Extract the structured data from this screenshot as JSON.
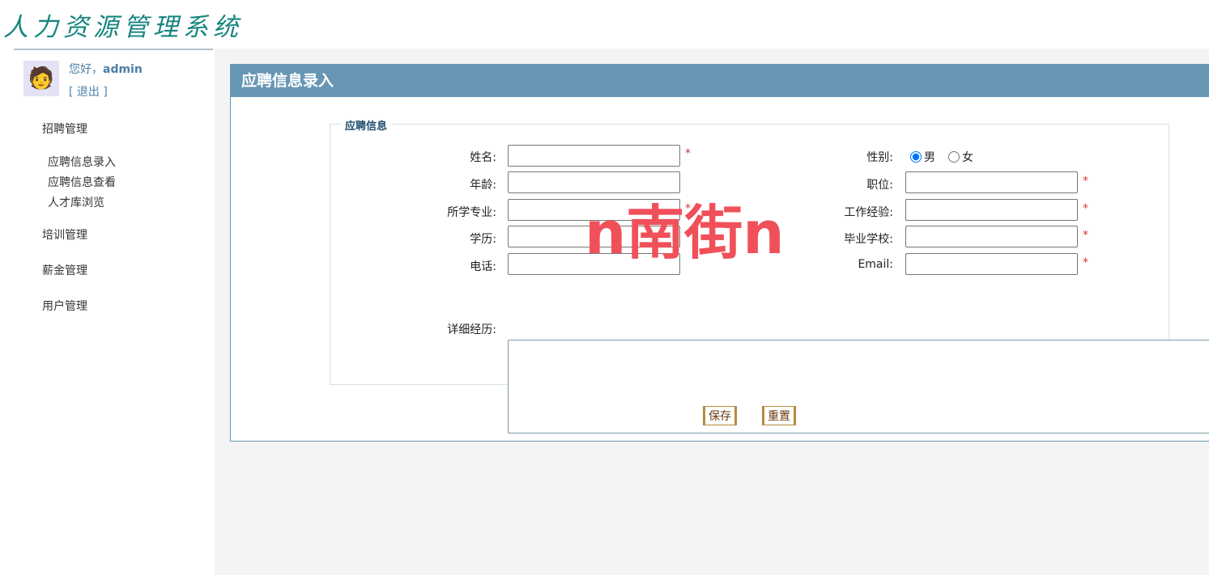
{
  "app": {
    "title": "人力资源管理系统"
  },
  "user": {
    "greeting": "您好，",
    "name": "admin",
    "logout": "[ 退出 ]"
  },
  "sidebar": {
    "groups": [
      {
        "label": "招聘管理",
        "items": [
          "应聘信息录入",
          "应聘信息查看",
          "人才库浏览"
        ]
      },
      {
        "label": "培训管理"
      },
      {
        "label": "薪金管理"
      },
      {
        "label": "用户管理"
      }
    ]
  },
  "panel": {
    "title": "应聘信息录入",
    "legend": "应聘信息",
    "fields": {
      "name": "姓名:",
      "gender": "性别:",
      "age": "年龄:",
      "position": "职位:",
      "major": "所学专业:",
      "experience": "工作经验:",
      "education": "学历:",
      "school": "毕业学校:",
      "phone": "电话:",
      "email": "Email:",
      "resume": "详细经历:"
    },
    "required_mark": "*",
    "gender_options": {
      "male": "男",
      "female": "女",
      "selected": "男"
    },
    "buttons": {
      "save": "保存",
      "reset": "重置"
    }
  },
  "watermark": "n南街n"
}
